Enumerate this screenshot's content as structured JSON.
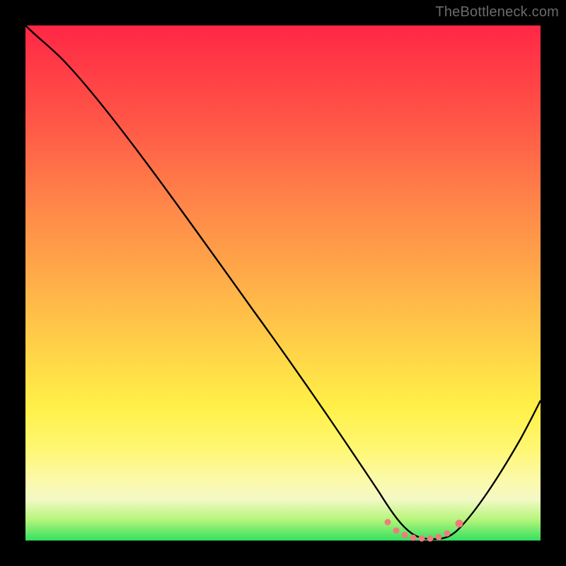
{
  "watermark": "TheBottleneck.com",
  "chart_data": {
    "type": "line",
    "title": "",
    "xlabel": "",
    "ylabel": "",
    "xlim": [
      0,
      100
    ],
    "ylim": [
      0,
      100
    ],
    "grid": false,
    "legend": false,
    "series": [
      {
        "name": "bottleneck-curve",
        "color": "#000000",
        "x": [
          0,
          4,
          8,
          12,
          16,
          20,
          24,
          28,
          32,
          36,
          40,
          44,
          48,
          52,
          56,
          60,
          64,
          68,
          70,
          72,
          74,
          76,
          78,
          80,
          82,
          84,
          86,
          88,
          92,
          96,
          100
        ],
        "y": [
          100,
          98,
          95,
          91,
          86,
          81,
          76,
          70,
          64,
          58,
          52,
          46,
          40,
          34,
          28,
          22,
          16,
          10,
          6,
          4,
          2,
          1,
          1,
          1,
          2,
          4,
          8,
          12,
          20,
          28,
          36
        ]
      },
      {
        "name": "valley-dots",
        "color": "#ef7c7c",
        "type": "scatter",
        "x": [
          70,
          72,
          74,
          76,
          78,
          80,
          82,
          84
        ],
        "y": [
          4,
          2,
          1,
          1,
          1,
          1,
          2,
          4
        ]
      }
    ],
    "background_gradient_stops": [
      {
        "pos": 0,
        "color": "#ff2745"
      },
      {
        "pos": 50,
        "color": "#ffb648"
      },
      {
        "pos": 80,
        "color": "#fff552"
      },
      {
        "pos": 100,
        "color": "#33e060"
      }
    ]
  }
}
